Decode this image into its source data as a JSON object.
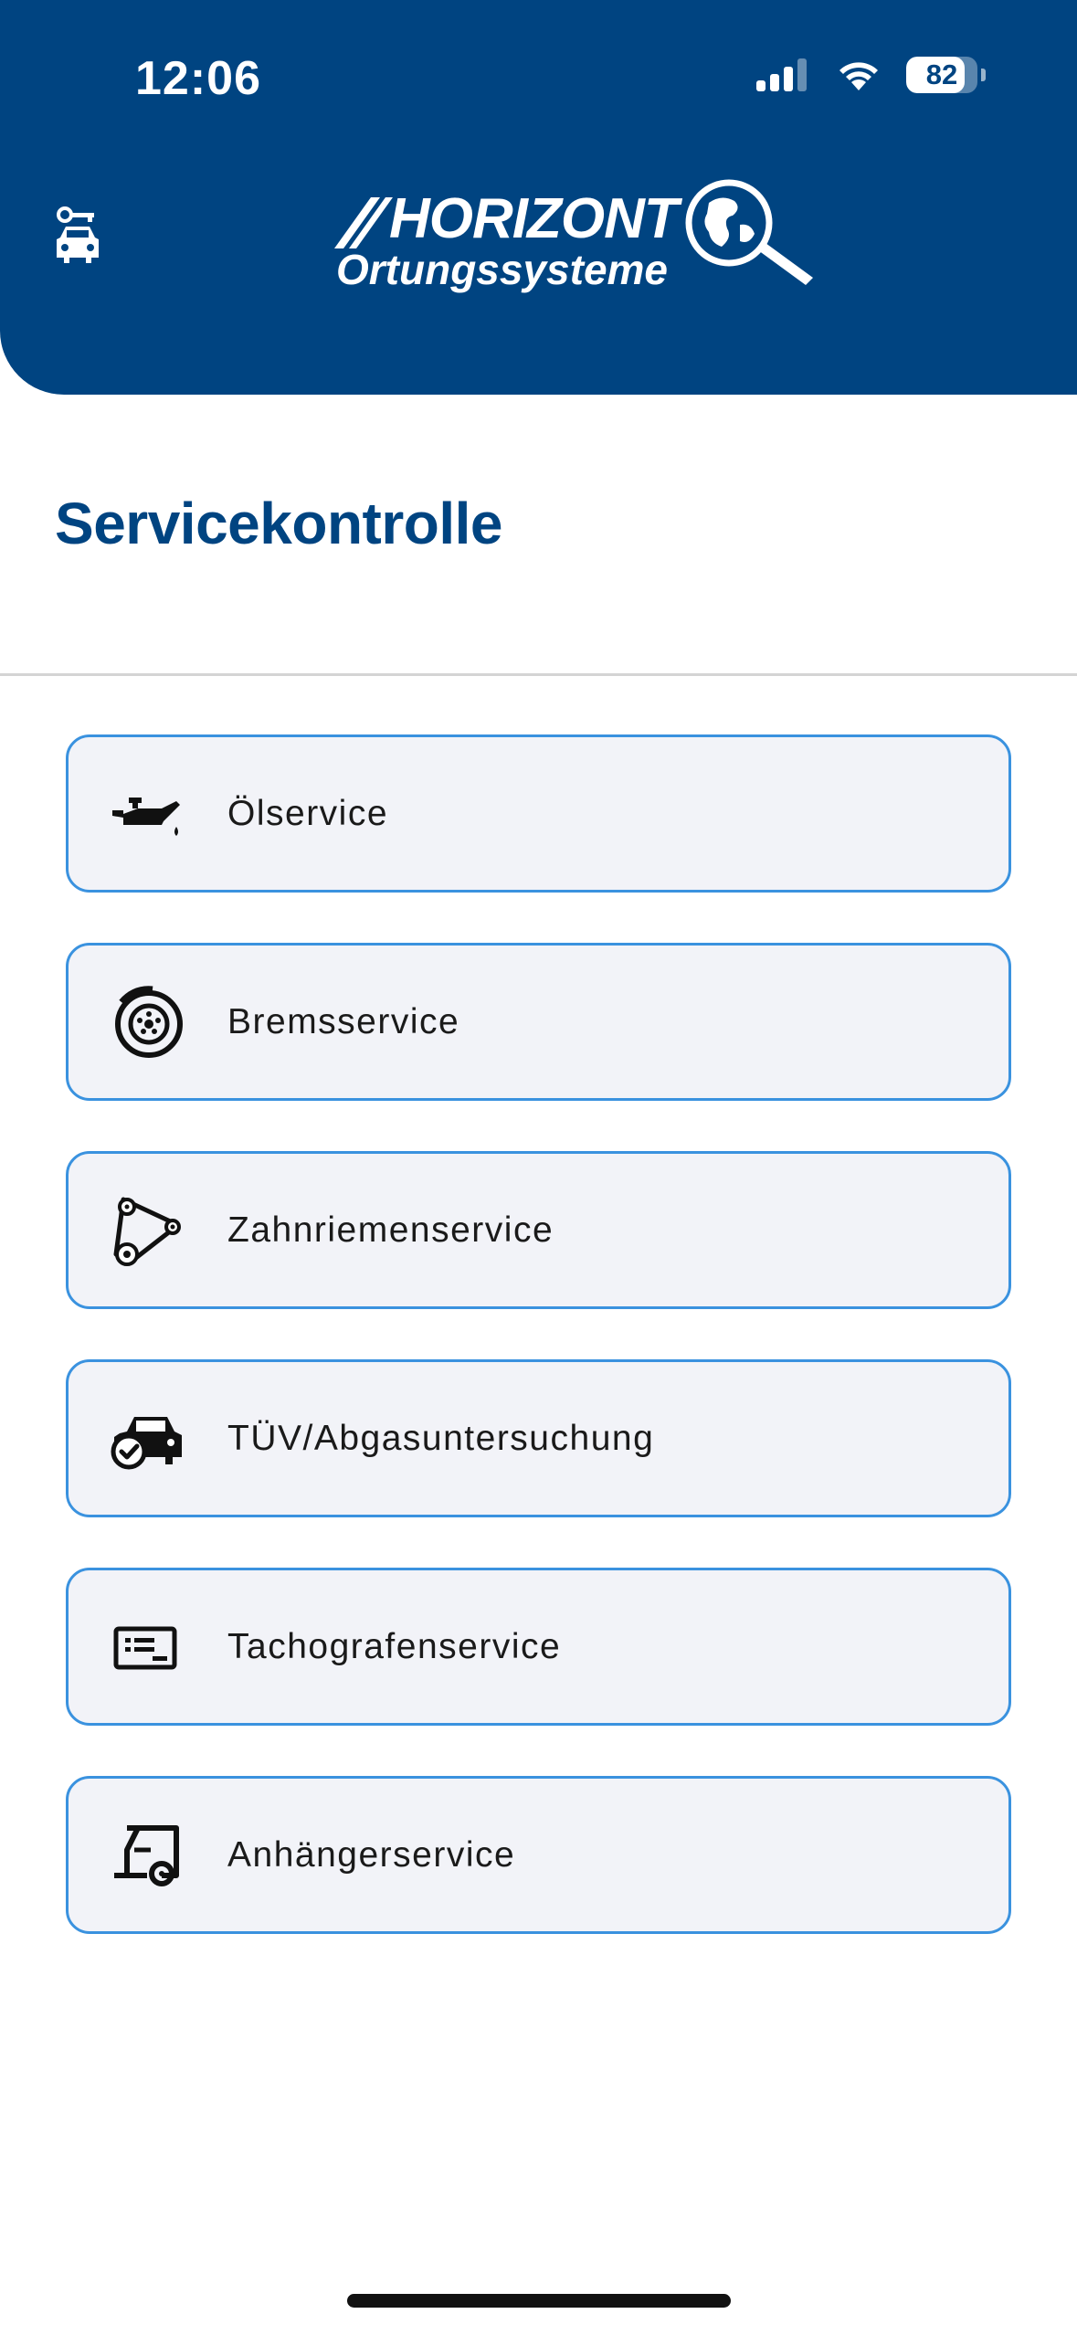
{
  "status_bar": {
    "time": "12:06",
    "battery": "82",
    "battery_level": 0.82
  },
  "header": {
    "logo_main": "HORIZONT",
    "logo_sub": "Ortungssysteme",
    "brand_color": "#004481"
  },
  "page": {
    "title": "Servicekontrolle"
  },
  "services": [
    {
      "label": "Ölservice",
      "icon": "oil-can-icon"
    },
    {
      "label": "Bremsservice",
      "icon": "brake-disc-icon"
    },
    {
      "label": "Zahnriemenservice",
      "icon": "timing-belt-icon"
    },
    {
      "label": "TÜV/Abgasuntersuchung",
      "icon": "car-check-icon"
    },
    {
      "label": "Tachografenservice",
      "icon": "tachograph-card-icon"
    },
    {
      "label": "Anhängerservice",
      "icon": "trailer-icon"
    }
  ],
  "colors": {
    "accent_border": "#3a92df",
    "item_bg": "#f2f3f8"
  }
}
